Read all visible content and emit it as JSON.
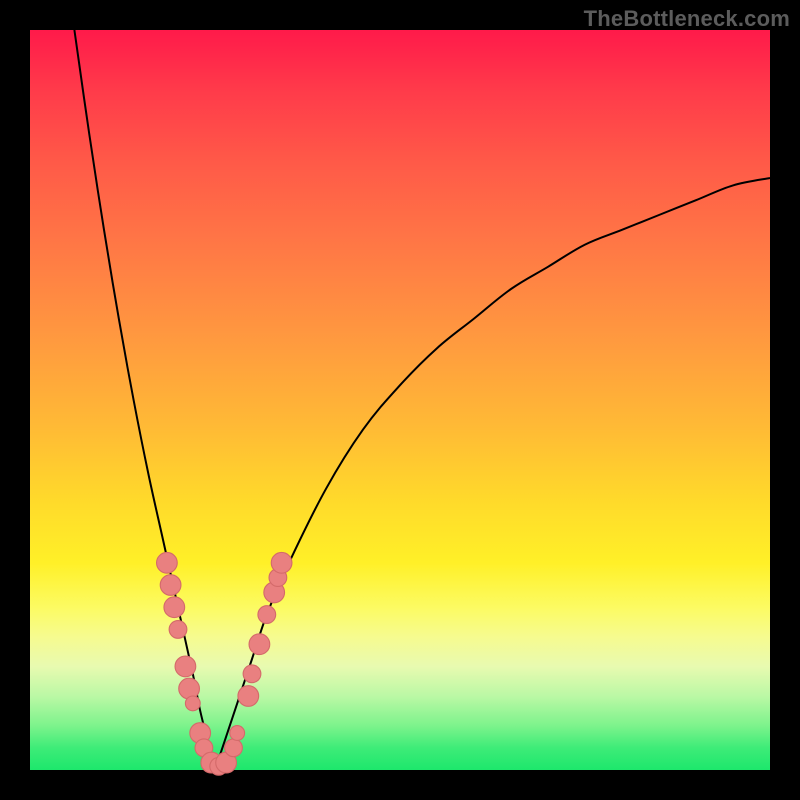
{
  "watermark": "TheBottleneck.com",
  "colors": {
    "curve": "#000000",
    "marker_fill": "#e98080",
    "marker_stroke": "#d46a6a",
    "bg_black": "#000000"
  },
  "chart_data": {
    "type": "line",
    "title": "",
    "xlabel": "",
    "ylabel": "",
    "xlim": [
      0,
      100
    ],
    "ylim": [
      0,
      100
    ],
    "grid": false,
    "legend": false,
    "notes": "V-shaped bottleneck curve. y≈0 at x≈25; rises steeply on both sides. Left branch reaches y≈100 by x≈6. Right branch rises asymptotically toward ~80 by x=100. Salmon markers cluster near the minimum on both branches.",
    "series": [
      {
        "name": "bottleneck_curve_left",
        "x": [
          6,
          8,
          10,
          12,
          14,
          16,
          18,
          20,
          22,
          23,
          24,
          25
        ],
        "y": [
          100,
          86,
          73,
          61,
          50,
          40,
          31,
          22,
          13,
          8,
          4,
          0
        ]
      },
      {
        "name": "bottleneck_curve_right",
        "x": [
          25,
          26,
          28,
          30,
          32,
          35,
          40,
          45,
          50,
          55,
          60,
          65,
          70,
          75,
          80,
          85,
          90,
          95,
          100
        ],
        "y": [
          0,
          3,
          9,
          15,
          21,
          28,
          38,
          46,
          52,
          57,
          61,
          65,
          68,
          71,
          73,
          75,
          77,
          79,
          80
        ]
      }
    ],
    "markers": [
      {
        "x": 18.5,
        "y": 28,
        "r": 1.4
      },
      {
        "x": 19.0,
        "y": 25,
        "r": 1.4
      },
      {
        "x": 19.5,
        "y": 22,
        "r": 1.4
      },
      {
        "x": 20.0,
        "y": 19,
        "r": 1.2
      },
      {
        "x": 21.0,
        "y": 14,
        "r": 1.4
      },
      {
        "x": 21.5,
        "y": 11,
        "r": 1.4
      },
      {
        "x": 22.0,
        "y": 9,
        "r": 1.0
      },
      {
        "x": 23.0,
        "y": 5,
        "r": 1.4
      },
      {
        "x": 23.5,
        "y": 3,
        "r": 1.2
      },
      {
        "x": 24.5,
        "y": 1,
        "r": 1.4
      },
      {
        "x": 25.5,
        "y": 0.5,
        "r": 1.2
      },
      {
        "x": 26.5,
        "y": 1,
        "r": 1.4
      },
      {
        "x": 27.5,
        "y": 3,
        "r": 1.2
      },
      {
        "x": 28.0,
        "y": 5,
        "r": 1.0
      },
      {
        "x": 29.5,
        "y": 10,
        "r": 1.4
      },
      {
        "x": 30.0,
        "y": 13,
        "r": 1.2
      },
      {
        "x": 31.0,
        "y": 17,
        "r": 1.4
      },
      {
        "x": 32.0,
        "y": 21,
        "r": 1.2
      },
      {
        "x": 33.0,
        "y": 24,
        "r": 1.4
      },
      {
        "x": 33.5,
        "y": 26,
        "r": 1.2
      },
      {
        "x": 34.0,
        "y": 28,
        "r": 1.4
      }
    ]
  }
}
